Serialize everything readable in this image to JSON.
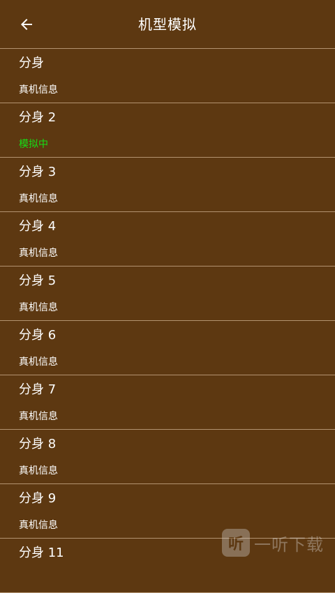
{
  "header": {
    "title": "机型模拟",
    "back_icon": "arrow-left-icon"
  },
  "colors": {
    "background": "#5d3811",
    "divider": "#b39370",
    "active_status": "#15e015"
  },
  "list": {
    "items": [
      {
        "title": "分身",
        "status": "真机信息",
        "active": false
      },
      {
        "title": "分身 2",
        "status": "模拟中",
        "active": true
      },
      {
        "title": "分身 3",
        "status": "真机信息",
        "active": false
      },
      {
        "title": "分身 4",
        "status": "真机信息",
        "active": false
      },
      {
        "title": "分身 5",
        "status": "真机信息",
        "active": false
      },
      {
        "title": "分身 6",
        "status": "真机信息",
        "active": false
      },
      {
        "title": "分身 7",
        "status": "真机信息",
        "active": false
      },
      {
        "title": "分身 8",
        "status": "真机信息",
        "active": false
      },
      {
        "title": "分身 9",
        "status": "真机信息",
        "active": false
      },
      {
        "title": "分身 11",
        "status": "",
        "active": false
      }
    ]
  },
  "watermark": {
    "text": "一听下载",
    "logo": "听"
  }
}
